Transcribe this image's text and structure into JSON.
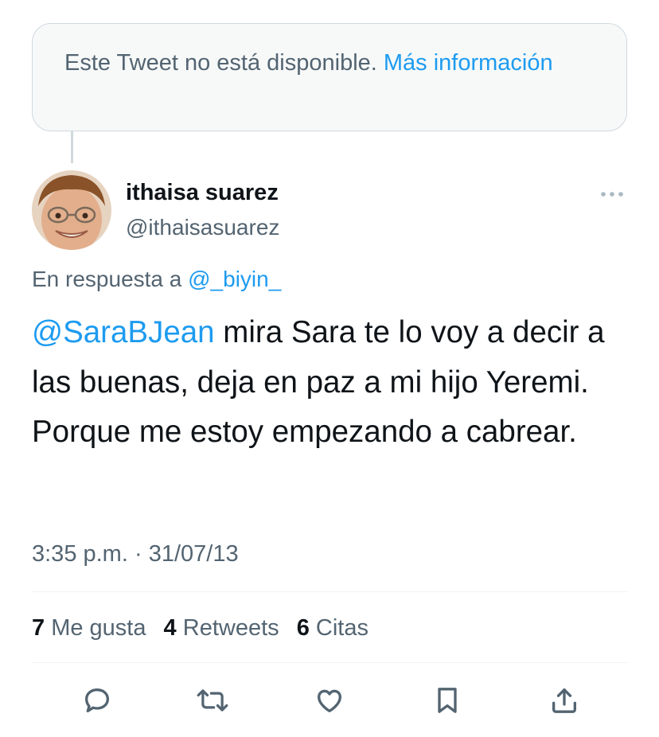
{
  "quoted_notice": {
    "text": "Este Tweet no está disponible. ",
    "link": "Más información"
  },
  "author": {
    "name": "ithaisa suarez",
    "handle": "@ithaisasuarez"
  },
  "reply_context": {
    "prefix": "En respuesta a ",
    "mention": "@_biyin_"
  },
  "tweet": {
    "mention": "@SaraBJean",
    "text": " mira Sara te lo voy a decir a las buenas, deja en paz a mi hijo Yeremi. Porque me estoy empezando a cabrear."
  },
  "meta": {
    "time": "3:35 p.m.",
    "separator": " · ",
    "date": "31/07/13"
  },
  "stats": {
    "likes_count": "7",
    "likes_label": " Me gusta",
    "retweets_count": "4",
    "retweets_label": " Retweets",
    "quotes_count": "6",
    "quotes_label": " Citas"
  },
  "colors": {
    "accent": "#1d9bf0",
    "secondary_text": "#536471",
    "primary_text": "#0f1419",
    "border": "#cfd9de"
  },
  "icons": [
    "more-icon",
    "reply-icon",
    "retweet-icon",
    "like-icon",
    "bookmark-icon",
    "share-icon"
  ]
}
